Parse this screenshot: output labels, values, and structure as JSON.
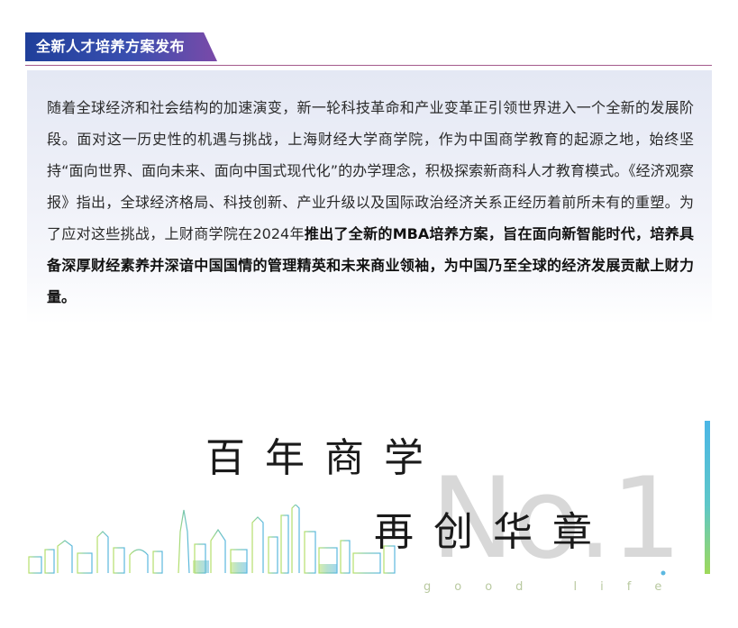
{
  "section": {
    "title": "全新人才培养方案发布"
  },
  "body": {
    "text_regular": "随着全球经济和社会结构的加速演变，新一轮科技革命和产业变革正引领世界进入一个全新的发展阶段。面对这一历史性的机遇与挑战，上海财经大学商学院，作为中国商学教育的起源之地，始终坚持“面向世界、面向未来、面向中国式现代化”的办学理念，积极探索新商科人才教育模式。《经济观察报》指出，全球经济格局、科技创新、产业升级以及国际政治经济关系正经历着前所未有的重塑。为了应对这些挑战，上财商学院在2024年",
    "text_bold": "推出了全新的MBA培养方案，旨在面向新智能时代，培养具备深厚财经素养并深谙中国国情的管理精英和未来商业领袖，为中国乃至全球的经济发展贡献上财力量。"
  },
  "banner": {
    "headline_1": "百年商学",
    "headline_2": "再创华章",
    "watermark": "No.1",
    "tagline": "good life"
  },
  "colors": {
    "title_gradient_start": "#1f3f9a",
    "title_gradient_end": "#7a4aa8",
    "title_rule": "#a45a8c",
    "card_background": "#e4e8f4",
    "bar_top": "#4bb6e6",
    "bar_bottom": "#9ed95a",
    "skyline_left": "#b7e06a",
    "skyline_right": "#5bb8e0"
  },
  "icons": {
    "skyline": "city-skyline-illustration"
  }
}
